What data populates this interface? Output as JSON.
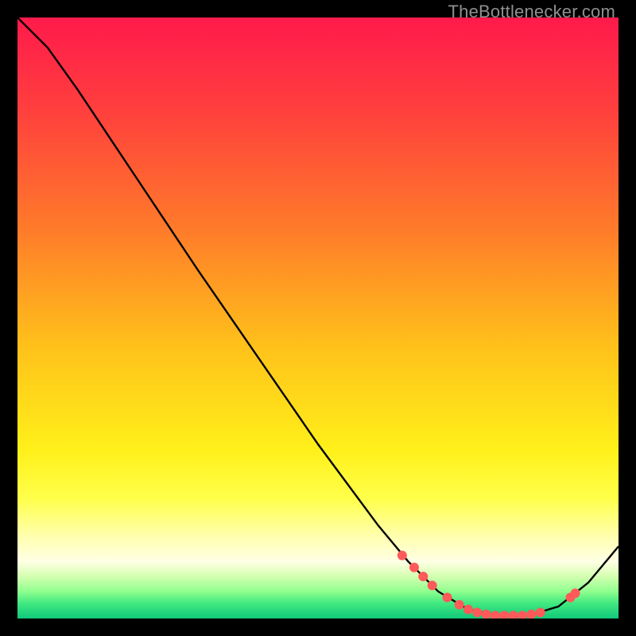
{
  "watermark": "TheBottlenecker.com",
  "chart_data": {
    "type": "line",
    "title": "",
    "xlabel": "",
    "ylabel": "",
    "xlim": [
      0,
      100
    ],
    "ylim": [
      0,
      100
    ],
    "gradient_stops": [
      {
        "offset": 0.0,
        "color": "#ff1a4b"
      },
      {
        "offset": 0.15,
        "color": "#ff3e3e"
      },
      {
        "offset": 0.35,
        "color": "#ff7a2a"
      },
      {
        "offset": 0.55,
        "color": "#ffc21a"
      },
      {
        "offset": 0.72,
        "color": "#fff01a"
      },
      {
        "offset": 0.8,
        "color": "#ffff4a"
      },
      {
        "offset": 0.86,
        "color": "#ffffaa"
      },
      {
        "offset": 0.905,
        "color": "#ffffe5"
      },
      {
        "offset": 0.93,
        "color": "#d4ffb0"
      },
      {
        "offset": 0.955,
        "color": "#8fff8f"
      },
      {
        "offset": 0.975,
        "color": "#40e880"
      },
      {
        "offset": 1.0,
        "color": "#10c97a"
      }
    ],
    "curve_points": [
      {
        "x": 0.0,
        "y": 100.0
      },
      {
        "x": 5.0,
        "y": 95.0
      },
      {
        "x": 10.0,
        "y": 88.0
      },
      {
        "x": 15.0,
        "y": 80.5
      },
      {
        "x": 20.0,
        "y": 73.0
      },
      {
        "x": 30.0,
        "y": 58.0
      },
      {
        "x": 40.0,
        "y": 43.5
      },
      {
        "x": 50.0,
        "y": 29.0
      },
      {
        "x": 60.0,
        "y": 15.5
      },
      {
        "x": 65.0,
        "y": 9.5
      },
      {
        "x": 70.0,
        "y": 4.5
      },
      {
        "x": 75.0,
        "y": 1.5
      },
      {
        "x": 80.0,
        "y": 0.5
      },
      {
        "x": 85.0,
        "y": 0.5
      },
      {
        "x": 90.0,
        "y": 2.0
      },
      {
        "x": 95.0,
        "y": 6.0
      },
      {
        "x": 100.0,
        "y": 12.0
      }
    ],
    "marker_points": [
      {
        "x": 64.0,
        "y": 10.5
      },
      {
        "x": 66.0,
        "y": 8.5
      },
      {
        "x": 67.5,
        "y": 7.0
      },
      {
        "x": 69.0,
        "y": 5.5
      },
      {
        "x": 71.5,
        "y": 3.5
      },
      {
        "x": 73.5,
        "y": 2.3
      },
      {
        "x": 75.0,
        "y": 1.5
      },
      {
        "x": 76.5,
        "y": 1.0
      },
      {
        "x": 78.0,
        "y": 0.7
      },
      {
        "x": 79.5,
        "y": 0.5
      },
      {
        "x": 81.0,
        "y": 0.5
      },
      {
        "x": 82.5,
        "y": 0.5
      },
      {
        "x": 84.0,
        "y": 0.5
      },
      {
        "x": 85.5,
        "y": 0.7
      },
      {
        "x": 87.0,
        "y": 1.0
      },
      {
        "x": 92.0,
        "y": 3.5
      },
      {
        "x": 92.8,
        "y": 4.2
      }
    ],
    "marker_color": "#ff5a5a",
    "curve_color": "#000000"
  }
}
